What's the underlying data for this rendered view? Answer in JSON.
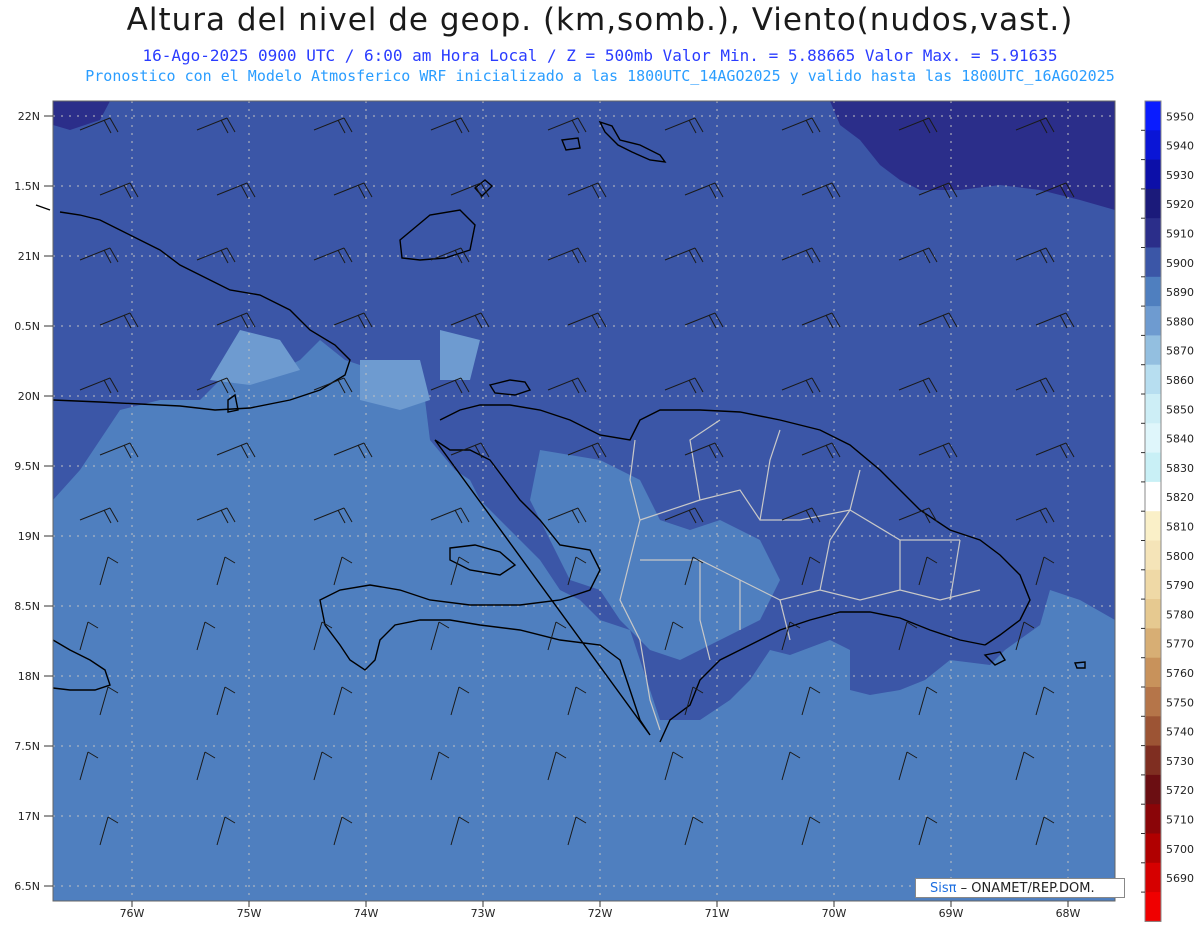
{
  "header": {
    "title": "Altura del nivel de geop. (km,somb.), Viento(nudos,vast.)",
    "line1": "16-Ago-2025  0900 UTC / 6:00 am Hora Local / Z = 500mb    Valor Min. = 5.88665  Valor Max. = 5.91635",
    "line2": "Pronostico con el Modelo Atmosferico WRF inicializado a las 1800UTC_14AGO2025 y valido hasta las  1800UTC_16AGO2025"
  },
  "map": {
    "lat_labels": [
      "22N",
      "1.5N",
      "21N",
      "0.5N",
      "20N",
      "9.5N",
      "19N",
      "8.5N",
      "18N",
      "7.5N",
      "17N",
      "6.5N"
    ],
    "lon_labels": [
      "76W",
      "75W",
      "74W",
      "73W",
      "72W",
      "71W",
      "70W",
      "69W",
      "68W"
    ],
    "colors": {
      "level_5890": "#4f7fbf",
      "level_5900": "#3b56a7",
      "level_5910": "#2b2e8a",
      "level_5880": "#6e9bd0",
      "coast": "#000000",
      "provinces": "#c8c8c8",
      "grid": "#c0c0c0"
    }
  },
  "colorbar": {
    "values": [
      "5950",
      "5940",
      "5930",
      "5920",
      "5910",
      "5900",
      "5890",
      "5880",
      "5870",
      "5860",
      "5850",
      "5840",
      "5830",
      "5820",
      "5810",
      "5800",
      "5790",
      "5780",
      "5770",
      "5760",
      "5750",
      "5740",
      "5730",
      "5720",
      "5710",
      "5700",
      "5690"
    ],
    "colors": [
      "#0a1cff",
      "#0a15d6",
      "#0c0fa8",
      "#1b1a7a",
      "#2b2e8a",
      "#3b56a7",
      "#4f7fbf",
      "#6e9bd0",
      "#93bfe0",
      "#b7def0",
      "#cdeef6",
      "#dff6fb",
      "#c9f0f6",
      "#ffffff",
      "#faf0c8",
      "#f5e4b8",
      "#efd9a6",
      "#e6c990",
      "#d7ae74",
      "#c8925b",
      "#b57549",
      "#9c5434",
      "#7f2e21",
      "#6b0e12",
      "#8a0508",
      "#b00000",
      "#d60000",
      "#f00000"
    ]
  },
  "credit": {
    "brand": "Sisπ",
    "text": " – ONAMET/REP.DOM."
  }
}
